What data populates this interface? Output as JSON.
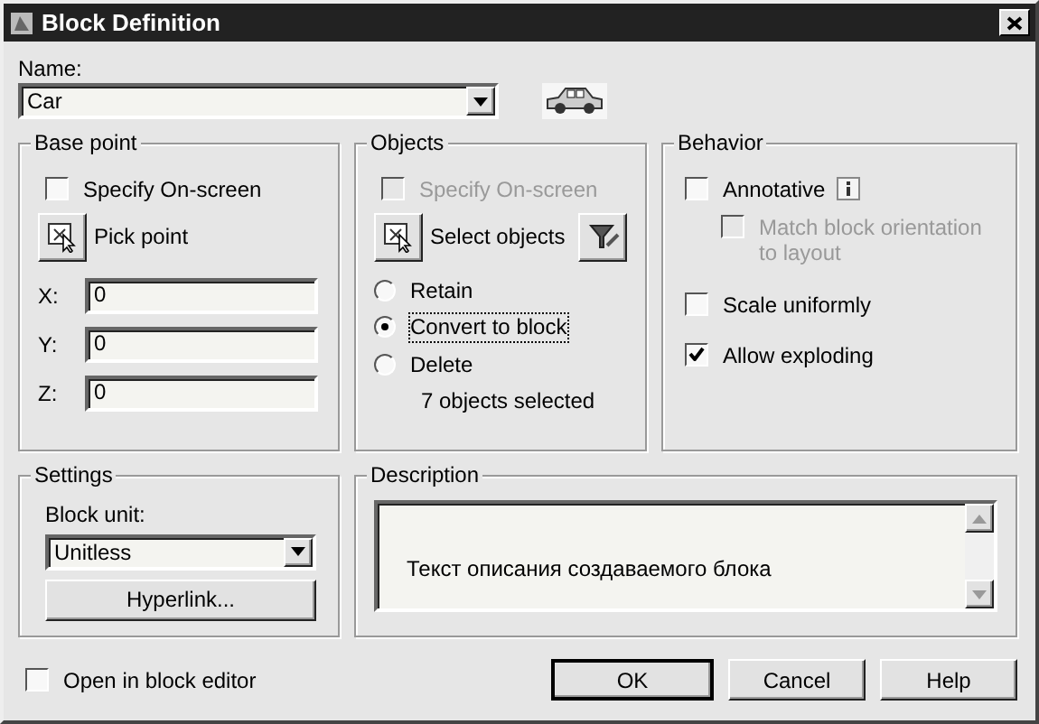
{
  "window": {
    "title": "Block Definition"
  },
  "name": {
    "label": "Name:",
    "value": "Car"
  },
  "base_point": {
    "title": "Base point",
    "specify_on_screen": {
      "label": "Specify On-screen",
      "checked": false,
      "disabled": false
    },
    "pick_button": "Pick point",
    "fields": [
      {
        "label": "X:",
        "value": "0"
      },
      {
        "label": "Y:",
        "value": "0"
      },
      {
        "label": "Z:",
        "value": "0"
      }
    ]
  },
  "objects": {
    "title": "Objects",
    "specify_on_screen": {
      "label": "Specify On-screen",
      "checked": false,
      "disabled": true
    },
    "select_button": "Select objects",
    "radios": [
      {
        "label": "Retain",
        "selected": false
      },
      {
        "label": "Convert to block",
        "selected": true
      },
      {
        "label": "Delete",
        "selected": false
      }
    ],
    "count_text": "7 objects selected"
  },
  "behavior": {
    "title": "Behavior",
    "options": [
      {
        "label": "Annotative",
        "checked": false,
        "disabled": false,
        "info": true,
        "children": [
          {
            "label": "Match block orientation to layout",
            "checked": false,
            "disabled": true
          }
        ]
      },
      {
        "label": "Scale uniformly",
        "checked": false,
        "disabled": false
      },
      {
        "label": "Allow exploding",
        "checked": true,
        "disabled": false
      }
    ]
  },
  "settings": {
    "title": "Settings",
    "block_unit_label": "Block unit:",
    "block_unit_value": "Unitless",
    "hyperlink_button": "Hyperlink..."
  },
  "description": {
    "title": "Description",
    "text": "Текст описания создаваемого блока"
  },
  "open_in_block_editor": {
    "label": "Open in block editor",
    "checked": false
  },
  "buttons": [
    {
      "label": "OK",
      "default": true
    },
    {
      "label": "Cancel",
      "default": false
    },
    {
      "label": "Help",
      "default": false
    }
  ]
}
